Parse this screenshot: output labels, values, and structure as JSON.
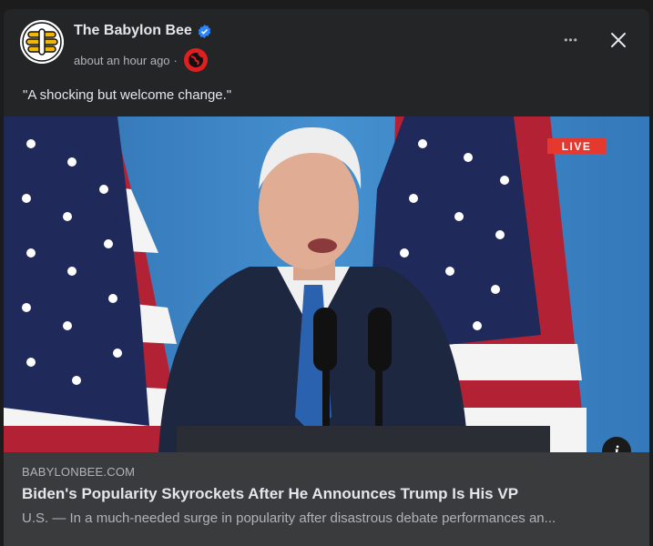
{
  "post": {
    "author": "The Babylon Bee",
    "timestamp": "about an hour ago",
    "separator": "·",
    "caption": "\"A shocking but welcome change.\"",
    "more_label": "•••",
    "icons": {
      "avatar": "babylon-bee-logo",
      "verified": "verified-badge-icon",
      "audience": "globe-icon",
      "more": "more-options-icon",
      "close": "close-icon",
      "info": "info-icon"
    },
    "colors": {
      "verified": "#2d88ff",
      "live": "#e5382f",
      "card_bg": "#3a3b3c",
      "post_bg": "#242526"
    }
  },
  "image": {
    "live_badge": "LIVE",
    "info_label": "i"
  },
  "link": {
    "domain": "BABYLONBEE.COM",
    "headline": "Biden's Popularity Skyrockets After He Announces Trump Is His VP",
    "description": "U.S. — In a much-needed surge in popularity after disastrous debate performances an..."
  }
}
